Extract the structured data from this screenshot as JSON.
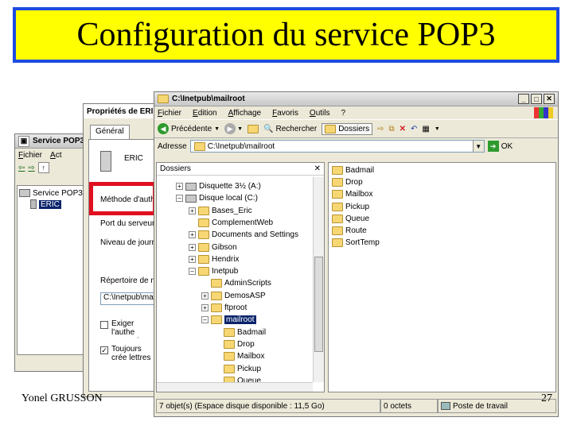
{
  "slide": {
    "title": "Configuration du service POP3",
    "author": "Yonel GRUSSON",
    "page_number": "27"
  },
  "mmc": {
    "title": "Service POP3",
    "menu": [
      "Fichier",
      "Act"
    ],
    "tree": [
      "Service POP3",
      "ERIC"
    ]
  },
  "properties": {
    "title": "Propriétés de ERI",
    "tab": "Général",
    "server_name": "ERIC",
    "labels": [
      "Méthode d'authe",
      "Port du serveur",
      "Niveau de journ",
      "Répertoire de m"
    ],
    "mailroot_value": "C:\\Inetpub\\mai",
    "checkbox1": "Exiger l'authe connexion s",
    "checkbox2": "Toujours crée lettres"
  },
  "explorer": {
    "title": "C:\\Inetpub\\mailroot",
    "menu": [
      "Fichier",
      "Edition",
      "Affichage",
      "Favoris",
      "Outils",
      "?"
    ],
    "toolbar": {
      "back": "Précédente",
      "search": "Rechercher",
      "folders": "Dossiers"
    },
    "address_label": "Adresse",
    "address_value": "C:\\Inetpub\\mailroot",
    "go_label": "OK",
    "folders_header": "Dossiers",
    "tree": [
      "Disquette 3½ (A:)",
      "Disque local (C:)",
      "Bases_Eric",
      "ComplementWeb",
      "Documents and Settings",
      "Gibson",
      "Hendrix",
      "Inetpub",
      "AdminScripts",
      "DemosASP",
      "ftproot",
      "mailroot",
      "Badmail",
      "Drop",
      "Mailbox",
      "Pickup",
      "Queue"
    ],
    "files": [
      "Badmail",
      "Drop",
      "Mailbox",
      "Pickup",
      "Queue",
      "Route",
      "SortTemp"
    ],
    "status": {
      "objects": "7 objet(s) (Espace disque disponible : 11,5 Go)",
      "size": "0 octets",
      "location": "Poste de travail"
    }
  }
}
